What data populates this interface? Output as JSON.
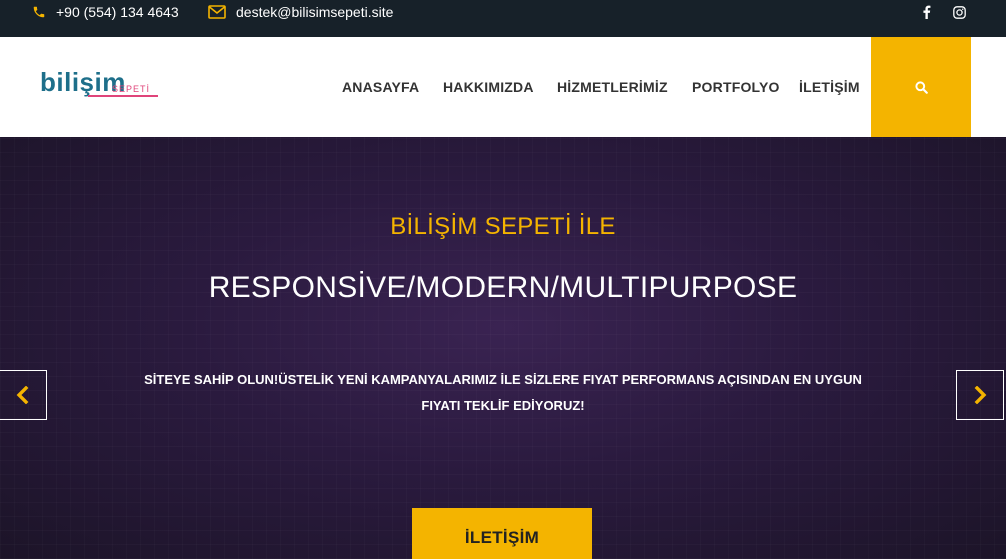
{
  "topbar": {
    "phone": "+90 (554) 134 4643",
    "email": "destek@bilisimsepeti.site",
    "phone_icon": "phone-icon",
    "email_icon": "envelope-icon",
    "social": [
      "facebook-icon",
      "instagram-icon"
    ]
  },
  "header": {
    "logo_main": "bilişim",
    "logo_sub": "SEPETİ",
    "nav": [
      {
        "label": "ANASAYFA"
      },
      {
        "label": "HAKKIMIZDA"
      },
      {
        "label": "HİZMETLERİMİZ"
      },
      {
        "label": "PORTFOLYO"
      },
      {
        "label": "İLETİŞİM"
      }
    ],
    "search_icon": "search-icon"
  },
  "hero": {
    "subtitle": "BİLİŞİM SEPETİ İLE",
    "title": "RESPONSİVE/MODERN/MULTIPURPOSE",
    "text_line1": "SİTEYE SAHİP OLUN!ÜSTELİK YENİ KAMPANYALARIMIZ İLE SİZLERE FIYAT PERFORMANS AÇISINDAN EN UYGUN",
    "text_line2": "FIYATI TEKLİF EDİYORUZ!",
    "cta_label": "İLETİŞİM",
    "prev_icon": "chevron-left-icon",
    "next_icon": "chevron-right-icon"
  },
  "colors": {
    "accent": "#f4b400",
    "topbar_bg": "#172129",
    "header_bg": "#ffffff",
    "hero_bg": "#2a1a3e"
  }
}
